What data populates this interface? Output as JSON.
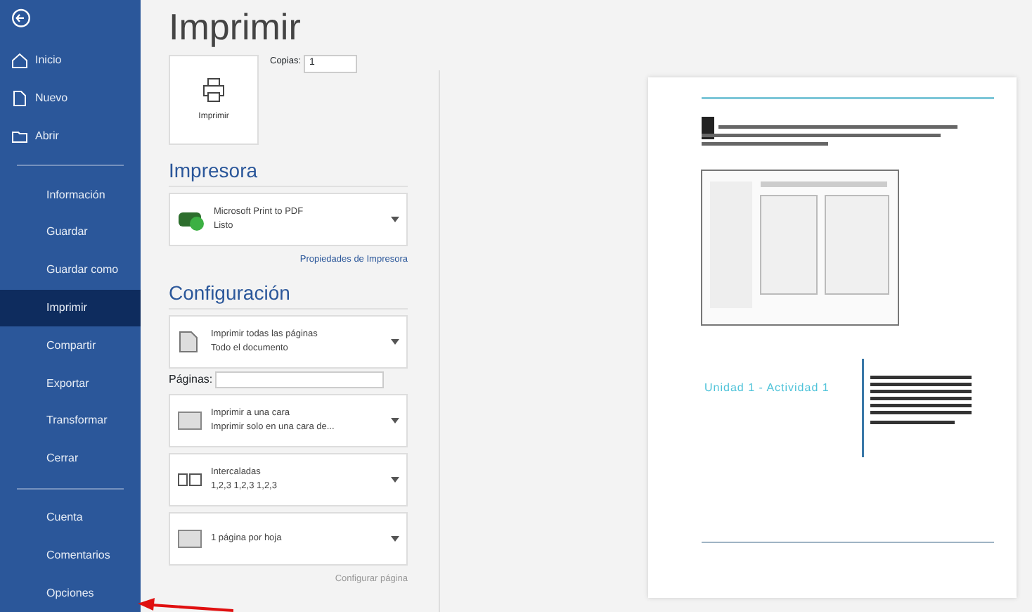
{
  "sidebar": {
    "top_items": [
      {
        "label": "Inicio",
        "kind": "home"
      },
      {
        "label": "Nuevo",
        "kind": "new"
      },
      {
        "label": "Abrir",
        "kind": "open"
      }
    ],
    "items": [
      {
        "label": "Información",
        "selected": false
      },
      {
        "label": "Guardar",
        "selected": false
      },
      {
        "label": "Guardar como",
        "selected": false
      },
      {
        "label": "Imprimir",
        "selected": true
      },
      {
        "label": "Compartir",
        "selected": false
      },
      {
        "label": "Exportar",
        "selected": false
      },
      {
        "label": "Transformar",
        "selected": false
      },
      {
        "label": "Cerrar",
        "selected": false
      }
    ],
    "bottom_items": [
      {
        "label": "Cuenta"
      },
      {
        "label": "Comentarios"
      },
      {
        "label": "Opciones"
      }
    ]
  },
  "title": "Imprimir",
  "print_button": "Imprimir",
  "copies": {
    "label": "Copias:",
    "value": "1"
  },
  "printer": {
    "heading": "Impresora",
    "name": "Microsoft Print to PDF",
    "status": "Listo",
    "properties_link": "Propiedades de Impresora"
  },
  "settings": {
    "heading": "Configuración",
    "items": [
      {
        "kind": "pages",
        "main": "Imprimir todas las páginas",
        "sub": "Todo el documento"
      },
      {
        "kind": "field",
        "label": "Páginas:"
      },
      {
        "kind": "sides",
        "main": "Imprimir a una cara",
        "sub": "Imprimir solo en una cara de..."
      },
      {
        "kind": "collate",
        "main": "Intercaladas",
        "sub": "1,2,3   1,2,3   1,2,3"
      },
      {
        "kind": "persheet",
        "main": "1 página por hoja"
      }
    ],
    "page_setup_link": "Configurar página"
  },
  "preview": {
    "title": "Unidad 1 - Actividad 1"
  }
}
